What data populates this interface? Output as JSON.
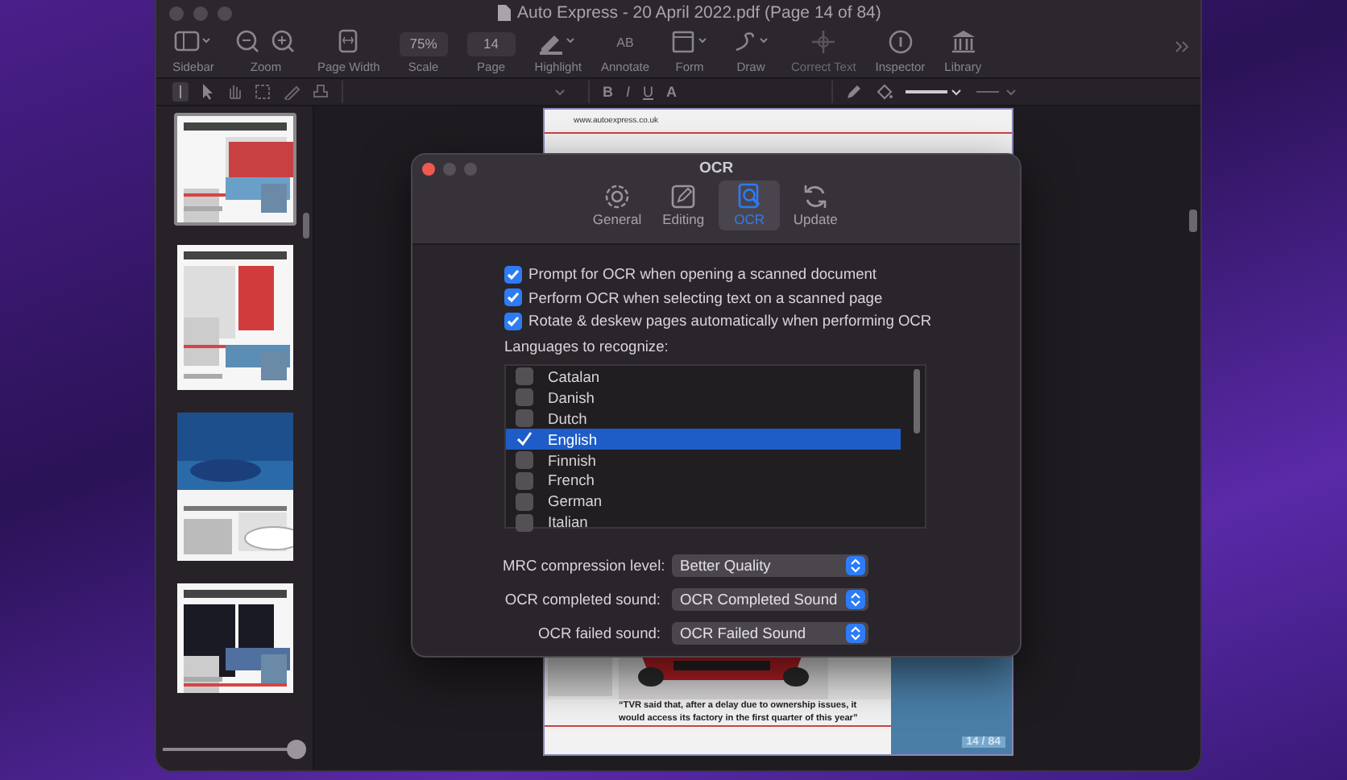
{
  "window": {
    "title": "Auto Express - 20 April 2022.pdf (Page 14 of 84)"
  },
  "toolbar": [
    {
      "kind": "sidebar",
      "label": "Sidebar",
      "disabled": false
    },
    {
      "kind": "zoom",
      "label": "Zoom",
      "disabled": false
    },
    {
      "kind": "pagewidth",
      "label": "Page Width",
      "disabled": false
    },
    {
      "kind": "field",
      "label": "Scale",
      "value": "75%",
      "disabled": false
    },
    {
      "kind": "field",
      "label": "Page",
      "value": "14",
      "disabled": false
    },
    {
      "kind": "highlight",
      "label": "Highlight",
      "disabled": false
    },
    {
      "kind": "annotate",
      "label": "Annotate",
      "value": "AB",
      "disabled": false
    },
    {
      "kind": "form",
      "label": "Form",
      "disabled": false
    },
    {
      "kind": "draw",
      "label": "Draw",
      "disabled": false
    },
    {
      "kind": "correct",
      "label": "Correct Text",
      "disabled": true
    },
    {
      "kind": "inspector",
      "label": "Inspector",
      "disabled": false
    },
    {
      "kind": "library",
      "label": "Library",
      "disabled": false
    }
  ],
  "format_buttons": [
    "B",
    "I",
    "U",
    "A"
  ],
  "thumbnails": [
    {
      "selected": true
    },
    {
      "selected": false
    },
    {
      "selected": false
    },
    {
      "selected": false
    }
  ],
  "thumbnail_size": {
    "level": 0.97
  },
  "page": {
    "url": "www.autoexpress.co.uk",
    "quote": "“TVR said that, after a delay due to ownership issues, it would access its factory in the first quarter of this year”",
    "page_number": "14 / 84"
  },
  "dialog": {
    "title": "OCR",
    "tabs": [
      {
        "kind": "general",
        "label": "General",
        "selected": false
      },
      {
        "kind": "editing",
        "label": "Editing",
        "selected": false
      },
      {
        "kind": "ocr",
        "label": "OCR",
        "selected": true
      },
      {
        "kind": "update",
        "label": "Update",
        "selected": false
      }
    ],
    "options": [
      {
        "label": "Prompt for OCR when opening a scanned document",
        "checked": true
      },
      {
        "label": "Perform OCR when selecting text on a scanned page",
        "checked": true
      },
      {
        "label": "Rotate & deskew pages automatically when performing OCR",
        "checked": true
      }
    ],
    "languages_label": "Languages to recognize:",
    "languages": [
      {
        "label": "Catalan",
        "checked": false,
        "selected": false
      },
      {
        "label": "Danish",
        "checked": false,
        "selected": false
      },
      {
        "label": "Dutch",
        "checked": false,
        "selected": false
      },
      {
        "label": "English",
        "checked": true,
        "selected": true
      },
      {
        "label": "Finnish",
        "checked": false,
        "selected": false
      },
      {
        "label": "French",
        "checked": false,
        "selected": false
      },
      {
        "label": "German",
        "checked": false,
        "selected": false
      },
      {
        "label": "Italian",
        "checked": false,
        "selected": false
      }
    ],
    "selects": [
      {
        "label": "MRC compression level:",
        "value": "Better Quality"
      },
      {
        "label": "OCR completed sound:",
        "value": "OCR Completed Sound"
      },
      {
        "label": "OCR failed sound:",
        "value": "OCR Failed Sound"
      }
    ]
  }
}
